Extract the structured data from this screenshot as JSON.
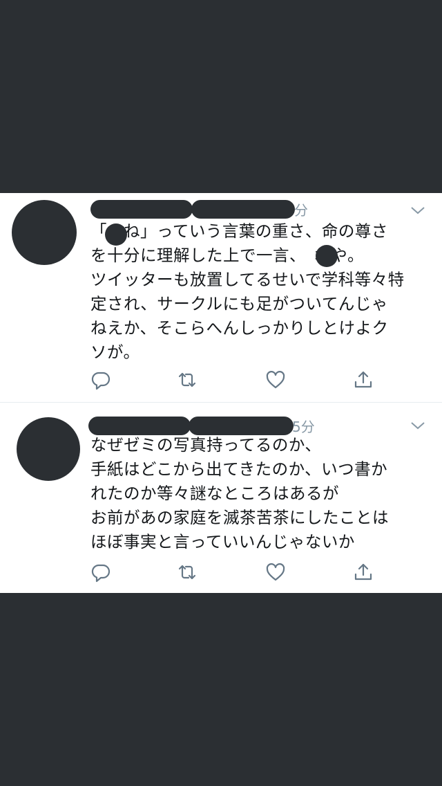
{
  "tweets": [
    {
      "time_suffix": "分",
      "text": "「　ね」っていう言葉の重さ、命の尊さ\nを十分に理解した上で一言、　ねや。\nツイッターも放置してるせいで学科等々特\n定され、サークルにも足がついてんじゃ\nねえか、そこらへんしっかりしとけよク\nソが。",
      "actions": [
        "reply-icon",
        "retweet-icon",
        "like-icon",
        "share-icon"
      ]
    },
    {
      "time_suffix": "5分",
      "text": "なぜゼミの写真持ってるのか、\n手紙はどこから出てきたのか、いつ書か\nれたのか等々謎なところはあるが\nお前があの家庭を滅茶苦茶にしたことは\nほぼ事実と言っていいんじゃないか",
      "actions": [
        "reply-icon",
        "retweet-icon",
        "like-icon",
        "share-icon"
      ]
    }
  ],
  "colors": {
    "background": "#2b2f33",
    "card": "#ffffff",
    "icon": "#657786",
    "text": "#14171a",
    "muted": "#8899a6"
  }
}
